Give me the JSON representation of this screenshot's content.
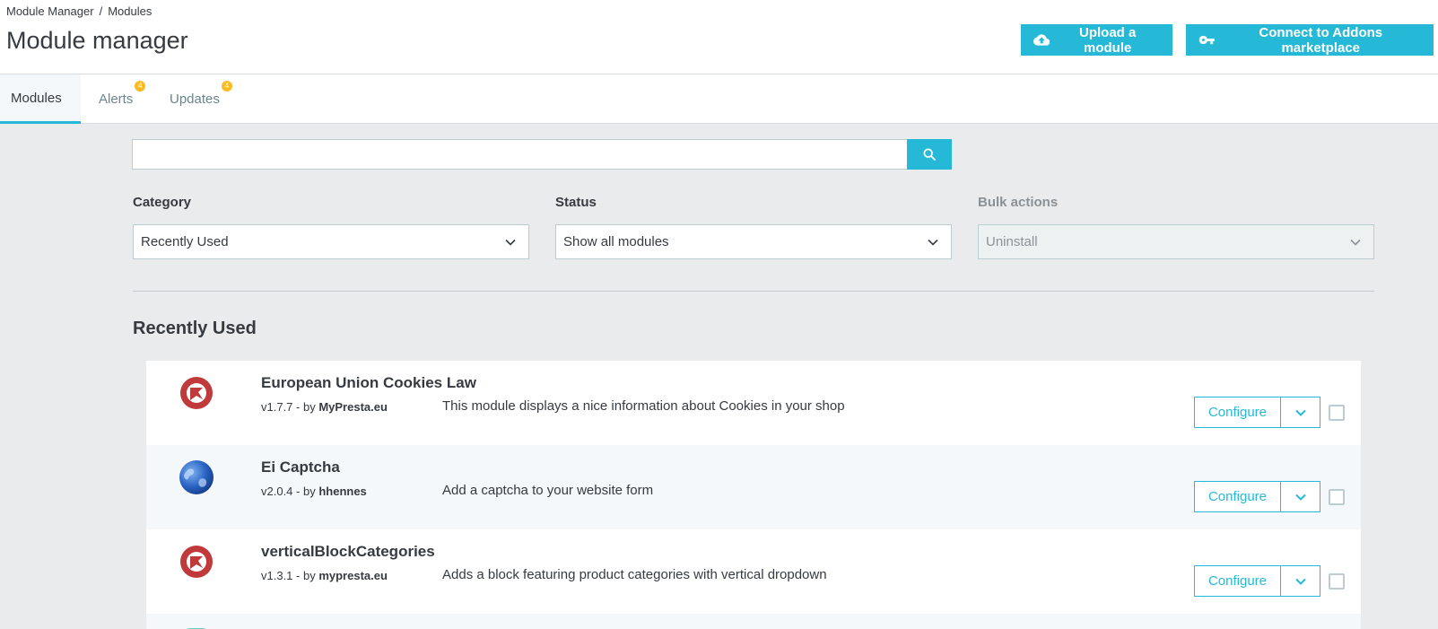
{
  "breadcrumb": {
    "items": [
      "Module Manager",
      "Modules"
    ],
    "separator": "/"
  },
  "header": {
    "title": "Module manager",
    "upload_label": "Upload a module",
    "connect_label": "Connect to Addons marketplace"
  },
  "tabs": [
    {
      "label": "Modules",
      "badge": ""
    },
    {
      "label": "Alerts",
      "badge": "4"
    },
    {
      "label": "Updates",
      "badge": "4"
    }
  ],
  "search": {
    "placeholder": ""
  },
  "filters": {
    "category_label": "Category",
    "category_value": "Recently Used",
    "status_label": "Status",
    "status_value": "Show all modules",
    "bulk_label": "Bulk actions",
    "bulk_value": "Uninstall"
  },
  "section_title": "Recently Used",
  "modules": [
    {
      "name": "European Union Cookies Law",
      "version": "v1.7.7 - by",
      "author": "MyPresta.eu",
      "description": "This module displays a nice information about Cookies in your shop",
      "configure_label": "Configure",
      "icon": "mypresta-logo-icon"
    },
    {
      "name": "Ei Captcha",
      "version": "v2.0.4 - by",
      "author": "hhennes",
      "description": "Add a captcha to your website form",
      "configure_label": "Configure",
      "icon": "globe-icon"
    },
    {
      "name": "verticalBlockCategories",
      "version": "v1.3.1 - by",
      "author": "mypresta.eu",
      "description": "Adds a block featuring product categories with vertical dropdown",
      "configure_label": "Configure",
      "icon": "mypresta-logo-icon"
    }
  ],
  "colors": {
    "accent": "#25b9d7",
    "badge": "#fbbb22",
    "logo_red": "#c0393b"
  }
}
